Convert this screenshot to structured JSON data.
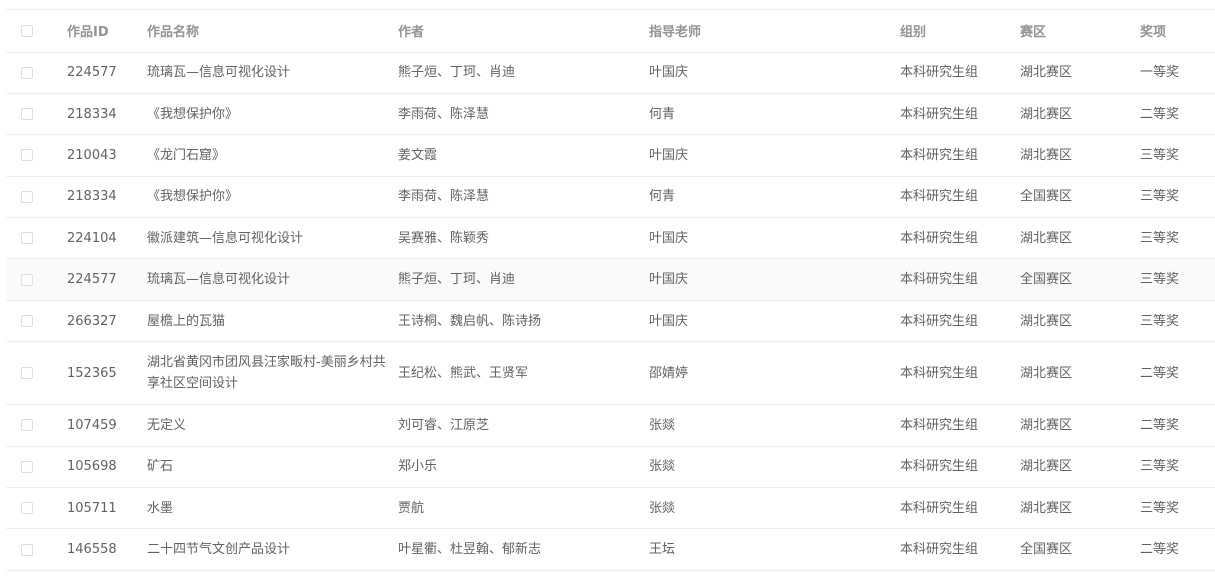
{
  "table": {
    "columns": [
      {
        "key": "select",
        "label": ""
      },
      {
        "key": "id",
        "label": "作品ID"
      },
      {
        "key": "name",
        "label": "作品名称"
      },
      {
        "key": "authors",
        "label": "作者"
      },
      {
        "key": "advisor",
        "label": "指导老师"
      },
      {
        "key": "group",
        "label": "组别"
      },
      {
        "key": "region",
        "label": "赛区"
      },
      {
        "key": "award",
        "label": "奖项"
      }
    ],
    "rows": [
      {
        "id": "224577",
        "name": "琉璃瓦—信息可视化设计",
        "authors": "熊子烜、丁珂、肖迪",
        "advisor": "叶国庆",
        "group": "本科研究生组",
        "region": "湖北赛区",
        "award": "一等奖"
      },
      {
        "id": "218334",
        "name": "《我想保护你》",
        "authors": "李雨荷、陈泽慧",
        "advisor": "何青",
        "group": "本科研究生组",
        "region": "湖北赛区",
        "award": "二等奖"
      },
      {
        "id": "210043",
        "name": "《龙门石窟》",
        "authors": "姜文霞",
        "advisor": "叶国庆",
        "group": "本科研究生组",
        "region": "湖北赛区",
        "award": "三等奖"
      },
      {
        "id": "218334",
        "name": "《我想保护你》",
        "authors": "李雨荷、陈泽慧",
        "advisor": "何青",
        "group": "本科研究生组",
        "region": "全国赛区",
        "award": "三等奖"
      },
      {
        "id": "224104",
        "name": "徽派建筑—信息可视化设计",
        "authors": "吴赛雅、陈颖秀",
        "advisor": "叶国庆",
        "group": "本科研究生组",
        "region": "湖北赛区",
        "award": "三等奖"
      },
      {
        "id": "224577",
        "name": "琉璃瓦—信息可视化设计",
        "authors": "熊子烜、丁珂、肖迪",
        "advisor": "叶国庆",
        "group": "本科研究生组",
        "region": "全国赛区",
        "award": "三等奖"
      },
      {
        "id": "266327",
        "name": "屋檐上的瓦猫",
        "authors": "王诗桐、魏启帆、陈诗扬",
        "advisor": "叶国庆",
        "group": "本科研究生组",
        "region": "湖北赛区",
        "award": "三等奖"
      },
      {
        "id": "152365",
        "name": "湖北省黄冈市团风县汪家畈村-美丽乡村共享社区空间设计",
        "authors": "王纪松、熊武、王贤军",
        "advisor": "邵婧婷",
        "group": "本科研究生组",
        "region": "湖北赛区",
        "award": "二等奖"
      },
      {
        "id": "107459",
        "name": "无定义",
        "authors": "刘可睿、江原芝",
        "advisor": "张燚",
        "group": "本科研究生组",
        "region": "湖北赛区",
        "award": "二等奖"
      },
      {
        "id": "105698",
        "name": "矿石",
        "authors": "郑小乐",
        "advisor": "张燚",
        "group": "本科研究生组",
        "region": "湖北赛区",
        "award": "三等奖"
      },
      {
        "id": "105711",
        "name": "水墨",
        "authors": "贾航",
        "advisor": "张燚",
        "group": "本科研究生组",
        "region": "湖北赛区",
        "award": "三等奖"
      },
      {
        "id": "146558",
        "name": "二十四节气文创产品设计",
        "authors": "叶星衢、杜昱翰、郁新志",
        "advisor": "王坛",
        "group": "本科研究生组",
        "region": "全国赛区",
        "award": "二等奖"
      }
    ],
    "tall_rows": [
      7
    ],
    "highlighted_rows": [
      5
    ]
  },
  "colors": {
    "border": "#ebeef5",
    "header_text": "#909399",
    "body_text": "#606266",
    "hover_row": "#fafafa"
  }
}
